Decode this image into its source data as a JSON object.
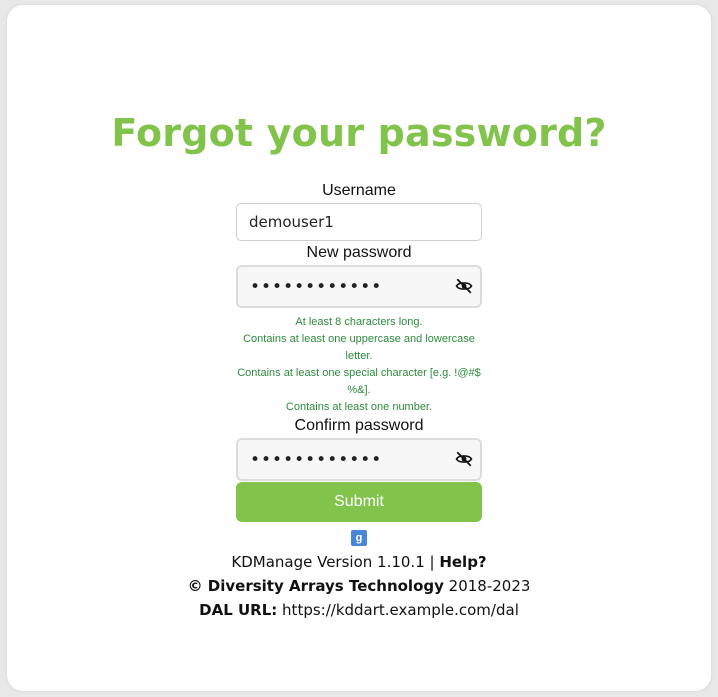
{
  "page": {
    "title": "Forgot your password?"
  },
  "form": {
    "username_label": "Username",
    "username_value": "demouser1",
    "new_password_label": "New password",
    "new_password_value": "••••••••••••",
    "confirm_password_label": "Confirm password",
    "confirm_password_value": "••••••••••••",
    "password_hints": [
      "At least 8 characters long.",
      "Contains at least one uppercase and lowercase letter.",
      "Contains at least one special character [e.g. !@#$ %&].",
      "Contains at least one number."
    ],
    "submit_label": "Submit"
  },
  "footer": {
    "translate_icon": "google-translate-icon",
    "translate_glyph": "g",
    "version_text": "KDManage Version 1.10.1 | ",
    "help_label": "Help?",
    "copyright_org": "© Diversity Arrays Technology",
    "copyright_years": " 2018-2023",
    "dal_label": "DAL URL:",
    "dal_url": " https://kddart.example.com/dal"
  },
  "colors": {
    "accent": "#82c34b",
    "hint_text": "#2e8b3e",
    "button_text": "#ffffff"
  }
}
